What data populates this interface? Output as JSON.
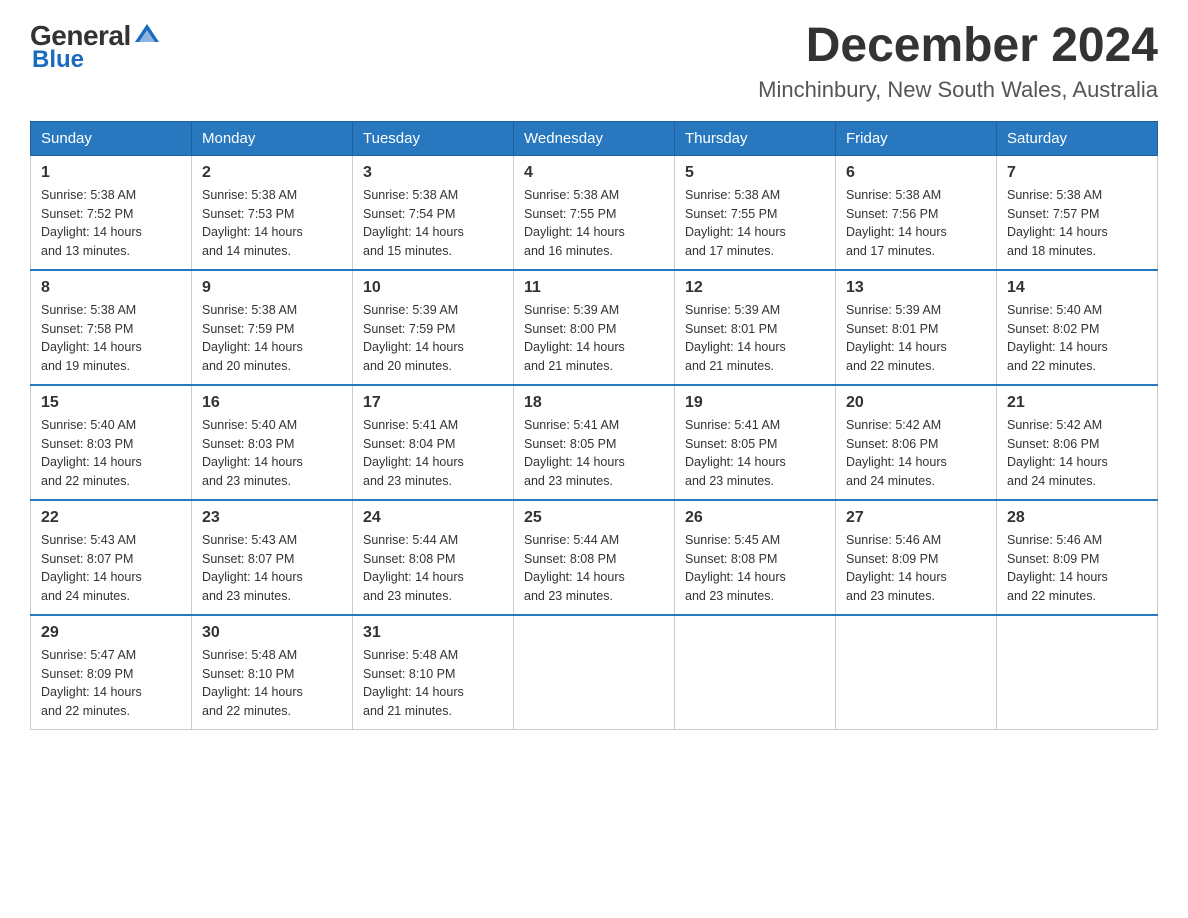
{
  "logo": {
    "general": "General",
    "blue": "Blue",
    "alt": "GeneralBlue logo"
  },
  "header": {
    "title": "December 2024",
    "subtitle": "Minchinbury, New South Wales, Australia"
  },
  "weekdays": [
    "Sunday",
    "Monday",
    "Tuesday",
    "Wednesday",
    "Thursday",
    "Friday",
    "Saturday"
  ],
  "weeks": [
    [
      {
        "day": "1",
        "sunrise": "5:38 AM",
        "sunset": "7:52 PM",
        "daylight": "14 hours and 13 minutes."
      },
      {
        "day": "2",
        "sunrise": "5:38 AM",
        "sunset": "7:53 PM",
        "daylight": "14 hours and 14 minutes."
      },
      {
        "day": "3",
        "sunrise": "5:38 AM",
        "sunset": "7:54 PM",
        "daylight": "14 hours and 15 minutes."
      },
      {
        "day": "4",
        "sunrise": "5:38 AM",
        "sunset": "7:55 PM",
        "daylight": "14 hours and 16 minutes."
      },
      {
        "day": "5",
        "sunrise": "5:38 AM",
        "sunset": "7:55 PM",
        "daylight": "14 hours and 17 minutes."
      },
      {
        "day": "6",
        "sunrise": "5:38 AM",
        "sunset": "7:56 PM",
        "daylight": "14 hours and 17 minutes."
      },
      {
        "day": "7",
        "sunrise": "5:38 AM",
        "sunset": "7:57 PM",
        "daylight": "14 hours and 18 minutes."
      }
    ],
    [
      {
        "day": "8",
        "sunrise": "5:38 AM",
        "sunset": "7:58 PM",
        "daylight": "14 hours and 19 minutes."
      },
      {
        "day": "9",
        "sunrise": "5:38 AM",
        "sunset": "7:59 PM",
        "daylight": "14 hours and 20 minutes."
      },
      {
        "day": "10",
        "sunrise": "5:39 AM",
        "sunset": "7:59 PM",
        "daylight": "14 hours and 20 minutes."
      },
      {
        "day": "11",
        "sunrise": "5:39 AM",
        "sunset": "8:00 PM",
        "daylight": "14 hours and 21 minutes."
      },
      {
        "day": "12",
        "sunrise": "5:39 AM",
        "sunset": "8:01 PM",
        "daylight": "14 hours and 21 minutes."
      },
      {
        "day": "13",
        "sunrise": "5:39 AM",
        "sunset": "8:01 PM",
        "daylight": "14 hours and 22 minutes."
      },
      {
        "day": "14",
        "sunrise": "5:40 AM",
        "sunset": "8:02 PM",
        "daylight": "14 hours and 22 minutes."
      }
    ],
    [
      {
        "day": "15",
        "sunrise": "5:40 AM",
        "sunset": "8:03 PM",
        "daylight": "14 hours and 22 minutes."
      },
      {
        "day": "16",
        "sunrise": "5:40 AM",
        "sunset": "8:03 PM",
        "daylight": "14 hours and 23 minutes."
      },
      {
        "day": "17",
        "sunrise": "5:41 AM",
        "sunset": "8:04 PM",
        "daylight": "14 hours and 23 minutes."
      },
      {
        "day": "18",
        "sunrise": "5:41 AM",
        "sunset": "8:05 PM",
        "daylight": "14 hours and 23 minutes."
      },
      {
        "day": "19",
        "sunrise": "5:41 AM",
        "sunset": "8:05 PM",
        "daylight": "14 hours and 23 minutes."
      },
      {
        "day": "20",
        "sunrise": "5:42 AM",
        "sunset": "8:06 PM",
        "daylight": "14 hours and 24 minutes."
      },
      {
        "day": "21",
        "sunrise": "5:42 AM",
        "sunset": "8:06 PM",
        "daylight": "14 hours and 24 minutes."
      }
    ],
    [
      {
        "day": "22",
        "sunrise": "5:43 AM",
        "sunset": "8:07 PM",
        "daylight": "14 hours and 24 minutes."
      },
      {
        "day": "23",
        "sunrise": "5:43 AM",
        "sunset": "8:07 PM",
        "daylight": "14 hours and 23 minutes."
      },
      {
        "day": "24",
        "sunrise": "5:44 AM",
        "sunset": "8:08 PM",
        "daylight": "14 hours and 23 minutes."
      },
      {
        "day": "25",
        "sunrise": "5:44 AM",
        "sunset": "8:08 PM",
        "daylight": "14 hours and 23 minutes."
      },
      {
        "day": "26",
        "sunrise": "5:45 AM",
        "sunset": "8:08 PM",
        "daylight": "14 hours and 23 minutes."
      },
      {
        "day": "27",
        "sunrise": "5:46 AM",
        "sunset": "8:09 PM",
        "daylight": "14 hours and 23 minutes."
      },
      {
        "day": "28",
        "sunrise": "5:46 AM",
        "sunset": "8:09 PM",
        "daylight": "14 hours and 22 minutes."
      }
    ],
    [
      {
        "day": "29",
        "sunrise": "5:47 AM",
        "sunset": "8:09 PM",
        "daylight": "14 hours and 22 minutes."
      },
      {
        "day": "30",
        "sunrise": "5:48 AM",
        "sunset": "8:10 PM",
        "daylight": "14 hours and 22 minutes."
      },
      {
        "day": "31",
        "sunrise": "5:48 AM",
        "sunset": "8:10 PM",
        "daylight": "14 hours and 21 minutes."
      },
      null,
      null,
      null,
      null
    ]
  ],
  "labels": {
    "sunrise": "Sunrise:",
    "sunset": "Sunset:",
    "daylight": "Daylight:"
  }
}
